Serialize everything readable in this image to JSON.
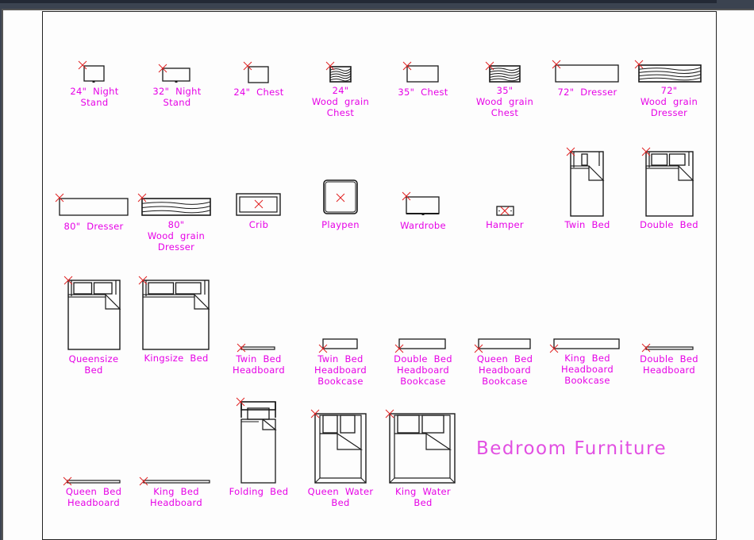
{
  "drawing": {
    "title": "Bedroom Furniture",
    "colors": {
      "label": "#e600e6",
      "marker": "#e02020",
      "line": "#1a1a1a",
      "background": "#fdfdfd"
    },
    "symbols": [
      {
        "id": "24-night-stand",
        "label": "24\"  Night\nStand"
      },
      {
        "id": "32-night-stand",
        "label": "32\"  Night\nStand"
      },
      {
        "id": "24-chest",
        "label": "24\"  Chest"
      },
      {
        "id": "24-wood-grain-chest",
        "label": "24\"\nWood  grain\nChest"
      },
      {
        "id": "35-chest",
        "label": "35\"  Chest"
      },
      {
        "id": "35-wood-grain-chest",
        "label": "35\"\nWood  grain\nChest"
      },
      {
        "id": "72-dresser",
        "label": "72\"  Dresser"
      },
      {
        "id": "72-wood-grain-dresser",
        "label": "72\"\nWood  grain\nDresser"
      },
      {
        "id": "80-dresser",
        "label": "80\"  Dresser"
      },
      {
        "id": "80-wood-grain-dresser",
        "label": "80\"\nWood  grain\nDresser"
      },
      {
        "id": "crib",
        "label": "Crib"
      },
      {
        "id": "playpen",
        "label": "Playpen"
      },
      {
        "id": "wardrobe",
        "label": "Wardrobe"
      },
      {
        "id": "hamper",
        "label": "Hamper"
      },
      {
        "id": "twin-bed",
        "label": "Twin  Bed"
      },
      {
        "id": "double-bed",
        "label": "Double  Bed"
      },
      {
        "id": "queensize-bed",
        "label": "Queensize\nBed"
      },
      {
        "id": "kingsize-bed",
        "label": "Kingsize  Bed"
      },
      {
        "id": "twin-bed-headboard",
        "label": "Twin  Bed\nHeadboard"
      },
      {
        "id": "twin-bed-headboard-bookcase",
        "label": "Twin  Bed\nHeadboard\nBookcase"
      },
      {
        "id": "double-bed-headboard-bookcase",
        "label": "Double  Bed\nHeadboard\nBookcase"
      },
      {
        "id": "queen-bed-headboard-bookcase",
        "label": "Queen  Bed\nHeadboard\nBookcase"
      },
      {
        "id": "king-bed-headboard-bookcase",
        "label": "King  Bed\nHeadboard\nBookcase"
      },
      {
        "id": "double-bed-headboard",
        "label": "Double  Bed\nHeadboard"
      },
      {
        "id": "queen-bed-headboard",
        "label": "Queen  Bed\nHeadboard"
      },
      {
        "id": "king-bed-headboard",
        "label": "King  Bed\nHeadboard"
      },
      {
        "id": "folding-bed",
        "label": "Folding  Bed"
      },
      {
        "id": "queen-water-bed",
        "label": "Queen  Water\nBed"
      },
      {
        "id": "king-water-bed",
        "label": "King  Water\nBed"
      }
    ]
  }
}
